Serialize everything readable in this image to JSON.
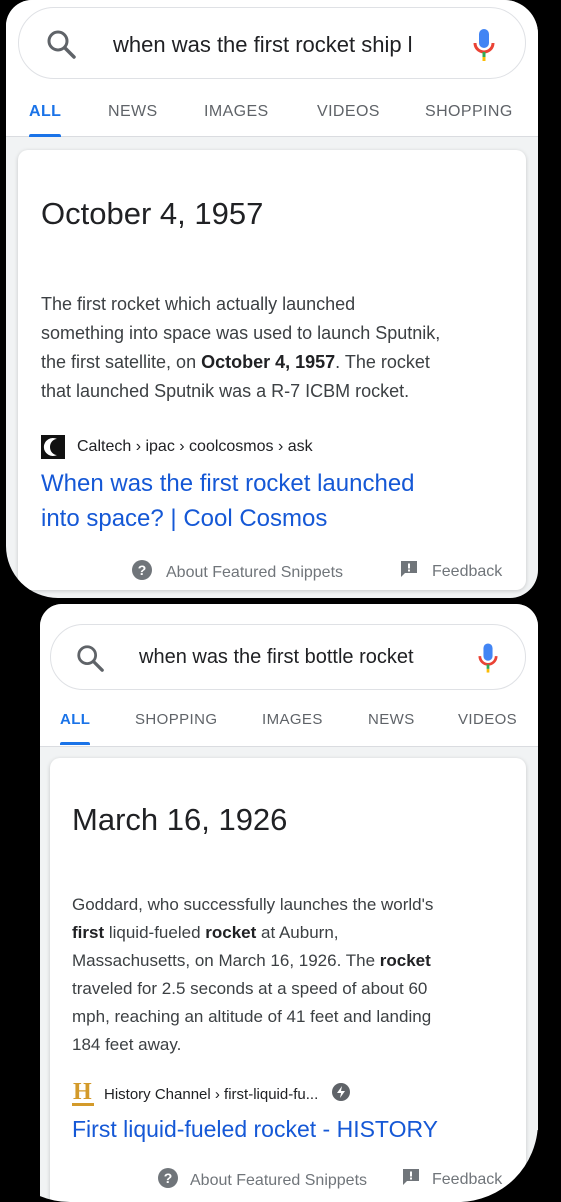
{
  "panel1": {
    "search": {
      "query": "when was the first rocket ship l"
    },
    "tabs": [
      "ALL",
      "NEWS",
      "IMAGES",
      "VIDEOS",
      "SHOPPING"
    ],
    "answer": "October 4, 1957",
    "snippet": {
      "l1": "The first rocket which actually launched",
      "l2": "something into space was used to launch Sputnik,",
      "l3a": "the first satellite, on ",
      "l3b": "October 4, 1957",
      "l3c": ". The rocket",
      "l4": "that launched Sputnik was a R-7 ICBM rocket."
    },
    "source": "Caltech › ipac › coolcosmos › ask",
    "result_link": {
      "l1": "When was the first rocket launched",
      "l2": "into space? | Cool Cosmos"
    },
    "footer": {
      "about": "About Featured Snippets",
      "feedback": "Feedback"
    }
  },
  "panel2": {
    "search": {
      "query": "when was the first bottle rocket"
    },
    "tabs": [
      "ALL",
      "SHOPPING",
      "IMAGES",
      "NEWS",
      "VIDEOS"
    ],
    "answer": "March 16, 1926",
    "snippet": {
      "l1": "Goddard, who successfully launches the world's",
      "l2a": "first",
      "l2b": " liquid-fueled ",
      "l2c": "rocket",
      "l2d": " at Auburn,",
      "l3": "Massachusetts, on March 16, 1926. The ",
      "l3b": "rocket",
      "l4": "traveled for 2.5 seconds at a speed of about 60",
      "l5": "mph, reaching an altitude of 41 feet and landing",
      "l6": "184 feet away."
    },
    "source": "History Channel › first-liquid-fu...",
    "source_logo_letter": "H",
    "result_link": "First liquid-fueled rocket - HISTORY",
    "footer": {
      "about": "About Featured Snippets",
      "feedback": "Feedback"
    }
  },
  "colors": {
    "link": "#1558d6",
    "tab_active": "#1a73e8",
    "text_secondary": "#70757a",
    "history_logo": "#d39a2a"
  }
}
